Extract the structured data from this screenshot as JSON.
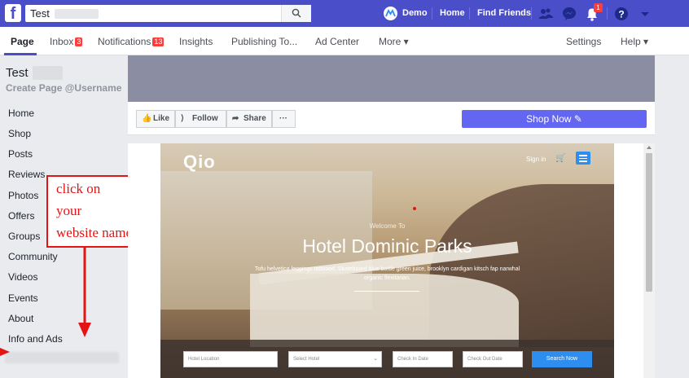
{
  "topbar": {
    "search_value": "Test",
    "user_name": "Demo",
    "home_label": "Home",
    "find_friends_label": "Find Friends",
    "notifications_count": "1"
  },
  "page_nav": {
    "page_label": "Page",
    "inbox_label": "Inbox",
    "inbox_count": "3",
    "notifications_label": "Notifications",
    "notifications_count": "13",
    "insights_label": "Insights",
    "publishing_label": "Publishing To...",
    "ad_center_label": "Ad Center",
    "more_label": "More ▾",
    "settings_label": "Settings",
    "help_label": "Help ▾"
  },
  "sidebar": {
    "page_name": "Test",
    "create_username": "Create Page @Username",
    "items": [
      {
        "label": "Home"
      },
      {
        "label": "Shop"
      },
      {
        "label": "Posts"
      },
      {
        "label": "Reviews"
      },
      {
        "label": "Photos"
      },
      {
        "label": "Offers"
      },
      {
        "label": "Groups"
      },
      {
        "label": "Community"
      },
      {
        "label": "Videos"
      },
      {
        "label": "Events"
      },
      {
        "label": "About"
      },
      {
        "label": "Info and Ads"
      }
    ]
  },
  "annotation": {
    "line1": "click on",
    "line2": "your",
    "line3": "website name",
    "color": "#e41414"
  },
  "actions": {
    "like_label": "Like",
    "follow_label": "Follow",
    "share_label": "Share",
    "more_label": "···",
    "shop_now_label": "Shop Now ✎"
  },
  "website": {
    "logo": "Qio",
    "signin_label": "Sign in",
    "welcome": "Welcome To",
    "title": "Hotel Dominic Parks",
    "description": "Tofu helvetica leggings tattooed. Skateboard blue bottle green juice, brooklyn cardigan kitsch fap narwhal organic flexitarian.",
    "fields": {
      "location_placeholder": "Hotel Location",
      "select_hotel": "Select Hotel",
      "check_in": "Check In Date",
      "check_out": "Check Out Date"
    },
    "search_button": "Search Now"
  },
  "colors": {
    "brand": "#4a4ec8",
    "shop_now": "#6366f1",
    "badge": "#fa3e3e",
    "site_button": "#2e8ef0"
  }
}
